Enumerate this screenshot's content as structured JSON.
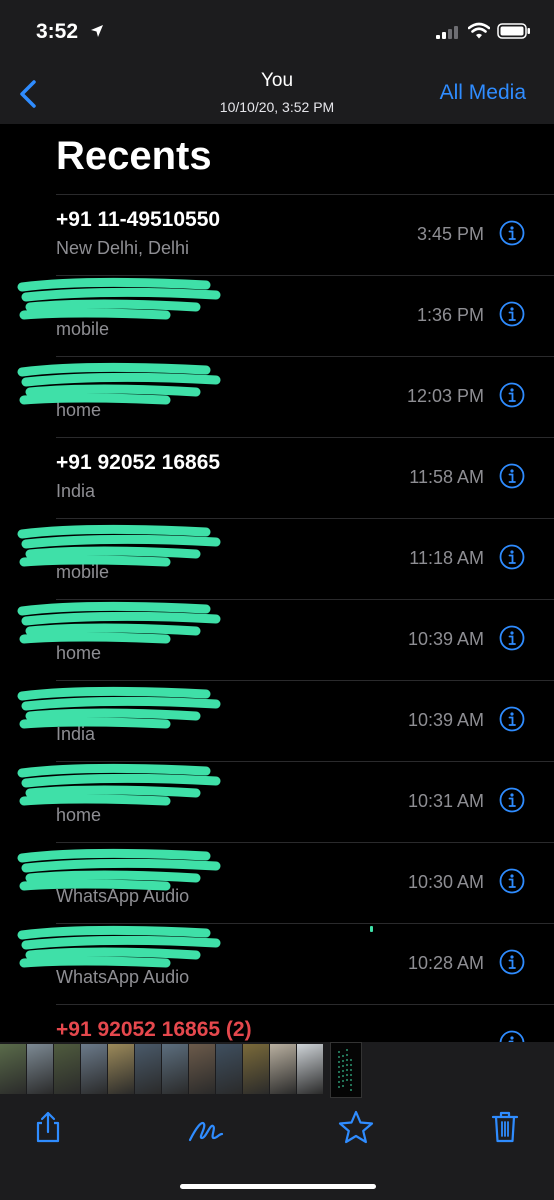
{
  "status_bar": {
    "time": "3:52"
  },
  "nav": {
    "title": "You",
    "subtitle": "10/10/20, 3:52 PM",
    "all_media": "All Media"
  },
  "screenshot": {
    "heading": "Recents",
    "calls": [
      {
        "name": "+91 11-49510550",
        "sub": "New Delhi, Delhi",
        "time": "3:45 PM",
        "missed": false,
        "redacted": false
      },
      {
        "name": "",
        "sub": "mobile",
        "time": "1:36 PM",
        "missed": false,
        "redacted": true
      },
      {
        "name": "",
        "sub": "home",
        "time": "12:03 PM",
        "missed": false,
        "redacted": true
      },
      {
        "name": "+91 92052 16865",
        "sub": "India",
        "time": "11:58 AM",
        "missed": false,
        "redacted": false
      },
      {
        "name": "",
        "sub": "mobile",
        "time": "11:18 AM",
        "missed": false,
        "redacted": true
      },
      {
        "name": "",
        "sub": "home",
        "time": "10:39 AM",
        "missed": false,
        "redacted": true
      },
      {
        "name": "",
        "sub": "India",
        "time": "10:39 AM",
        "missed": false,
        "redacted": true
      },
      {
        "name": "",
        "sub": "home",
        "time": "10:31 AM",
        "missed": false,
        "redacted": true
      },
      {
        "name": "",
        "sub": "WhatsApp Audio",
        "time": "10:30 AM",
        "missed": false,
        "redacted": true
      },
      {
        "name": "",
        "sub": "WhatsApp Audio",
        "time": "10:28 AM",
        "missed": false,
        "redacted": true
      },
      {
        "name": "+91 92052 16865 (2)",
        "sub": "",
        "time": "",
        "missed": true,
        "redacted": false
      }
    ]
  },
  "thumbnails": {
    "colors": [
      "#5a6b4a",
      "#7d8a94",
      "#4f5b3e",
      "#6b7a8a",
      "#9c8a5a",
      "#4a5a6a",
      "#5c6e7e",
      "#6b5a4a",
      "#3f4f5f",
      "#7a6a3a",
      "#b9b0a0",
      "#cfd4d8",
      "#0a0a0a"
    ],
    "selected_index": 12
  },
  "toolbar": {
    "icons": [
      "share-icon",
      "markup-icon",
      "favorite-icon",
      "delete-icon"
    ]
  },
  "colors": {
    "accent": "#2f8cff",
    "redaction": "#3fe0a8",
    "missed": "#e5484d"
  }
}
